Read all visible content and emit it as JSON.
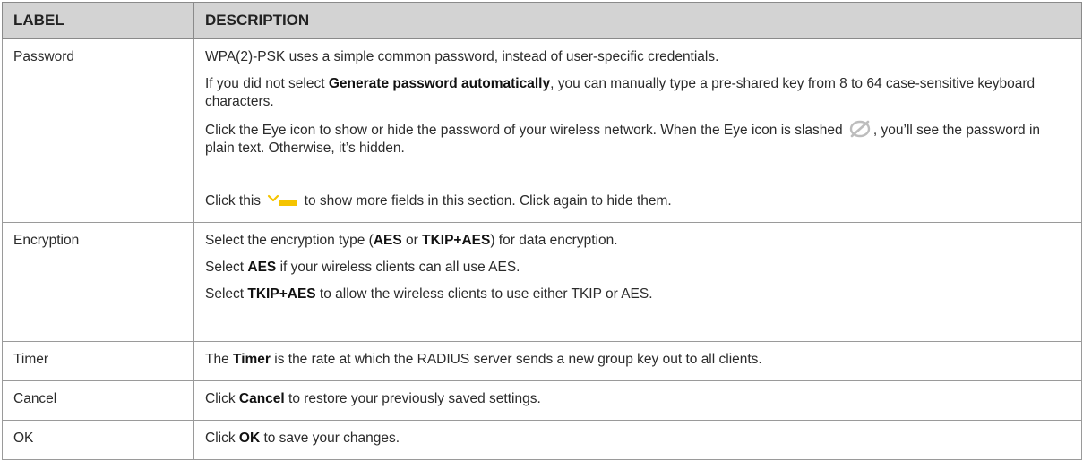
{
  "header": {
    "label": "LABEL",
    "description": "DESCRIPTION"
  },
  "rows": {
    "password": {
      "label": "Password",
      "p1": "WPA(2)-PSK uses a simple common password, instead of user-specific credentials.",
      "p2_a": "If you did not select ",
      "p2_b": "Generate password automatically",
      "p2_c": ", you can manually type a pre-shared key from 8 to 64 case-sensitive keyboard characters.",
      "p3_a": "Click the Eye icon to show or hide the password of your wireless network. When the Eye icon is slashed ",
      "p3_b": ", you’ll see the password in plain text. Otherwise, it’s hidden."
    },
    "more": {
      "label": "",
      "a": "Click this ",
      "b": " to show more fields in this section. Click again to hide them."
    },
    "encryption": {
      "label": "Encryption",
      "p1_a": "Select the encryption type (",
      "p1_b": "AES",
      "p1_c": " or ",
      "p1_d": "TKIP+AES",
      "p1_e": ") for data encryption.",
      "p2_a": "Select ",
      "p2_b": "AES",
      "p2_c": " if your wireless clients can all use AES.",
      "p3_a": "Select ",
      "p3_b": "TKIP+AES",
      "p3_c": " to allow the wireless clients to use either TKIP or AES."
    },
    "timer": {
      "label": "Timer",
      "a": "The ",
      "b": "Timer",
      "c": " is the rate at which the RADIUS server sends a new group key out to all clients."
    },
    "cancel": {
      "label": "Cancel",
      "a": "Click ",
      "b": "Cancel",
      "c": " to restore your previously saved settings."
    },
    "ok": {
      "label": "OK",
      "a": "Click ",
      "b": "OK",
      "c": " to save your changes."
    }
  },
  "colors": {
    "header_bg": "#d3d3d3",
    "border": "#9a9a9a",
    "eye_icon": "#bdbdbd",
    "expand_icon": "#f5c400"
  },
  "icons": [
    "eye-slashed-icon",
    "expand-more-icon"
  ]
}
